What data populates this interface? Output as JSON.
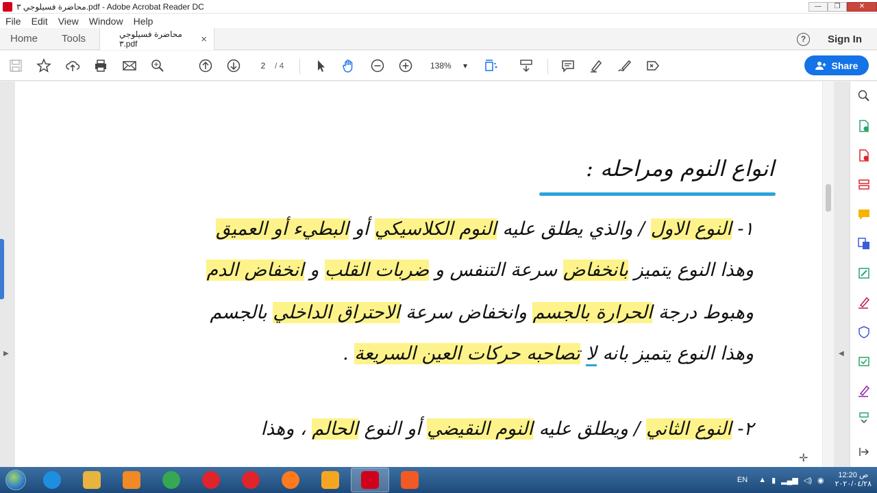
{
  "window": {
    "title": "محاضرة فسيلوجي ٣.pdf - Adobe Acrobat Reader DC",
    "controls": {
      "minimize": "—",
      "restore": "❐",
      "close": "✕"
    }
  },
  "menu": [
    "File",
    "Edit",
    "View",
    "Window",
    "Help"
  ],
  "tabs": {
    "home": "Home",
    "tools": "Tools",
    "document": "محاضرة فسيلوجي ٣.pdf",
    "close": "×"
  },
  "header_right": {
    "help": "?",
    "signin": "Sign In"
  },
  "toolbar": {
    "page_current": "2",
    "page_total": "/ 4",
    "zoom": "138%",
    "zoom_caret": "▾",
    "share": "Share"
  },
  "document": {
    "heading": "انواع النوم ومراحله :",
    "lines": [
      {
        "parts": [
          {
            "t": "١- "
          },
          {
            "t": "النوع الاول",
            "hl": true
          },
          {
            "t": " / والذي يطلق عليه "
          },
          {
            "t": "النوم الكلاسيكي",
            "hl": true
          },
          {
            "t": " أو "
          },
          {
            "t": "البطيء أو العميق",
            "hl": true
          }
        ]
      },
      {
        "parts": [
          {
            "t": "وهذا النوع يتميز "
          },
          {
            "t": "بانخفاض",
            "hl": true
          },
          {
            "t": " سرعة التنفس و "
          },
          {
            "t": "ضربات القلب",
            "hl": true
          },
          {
            "t": " و "
          },
          {
            "t": "انخفاض الدم",
            "hl": true
          }
        ]
      },
      {
        "parts": [
          {
            "t": "وهبوط درجة "
          },
          {
            "t": "الحرارة بالجسم",
            "hl": true
          },
          {
            "t": " وانخفاض سرعة "
          },
          {
            "t": "الاحتراق الداخلي",
            "hl": true
          },
          {
            "t": " بالجسم"
          }
        ]
      },
      {
        "parts": [
          {
            "t": "وهذا النوع يتميز بانه "
          },
          {
            "t": "لا",
            "ul": true
          },
          {
            "t": " "
          },
          {
            "t": "تصاحبه حركات العين السريعة",
            "hl": true
          },
          {
            "t": " ."
          }
        ]
      },
      {
        "parts": [
          {
            "t": "٢- "
          },
          {
            "t": "النوع الثاني",
            "hl": true
          },
          {
            "t": " / ويطلق عليه "
          },
          {
            "t": "النوم النقيضي",
            "hl": true
          },
          {
            "t": " أو النوع "
          },
          {
            "t": "الحالم",
            "hl": true
          },
          {
            "t": " ، وهذا"
          }
        ]
      }
    ]
  },
  "taskbar": {
    "apps": [
      {
        "name": "ie",
        "color": "#1e8fe0"
      },
      {
        "name": "explorer",
        "color": "#e8b33e"
      },
      {
        "name": "media",
        "color": "#f08a24"
      },
      {
        "name": "chrome",
        "color": "#34a853"
      },
      {
        "name": "opera",
        "color": "#e0242b"
      },
      {
        "name": "opera2",
        "color": "#e0242b"
      },
      {
        "name": "firefox",
        "color": "#ff7a1f"
      },
      {
        "name": "vlc",
        "color": "#f4a623"
      },
      {
        "name": "acrobat",
        "color": "#d0021b"
      },
      {
        "name": "camtasia",
        "color": "#f15a24"
      }
    ],
    "lang": "EN",
    "time": "ص 12:20",
    "date": "٢٠٢٠/٠٤/٢٨"
  },
  "colors": {
    "accent": "#1473e6",
    "highlight": "#fdf38a",
    "underline": "#2aa3dc"
  }
}
